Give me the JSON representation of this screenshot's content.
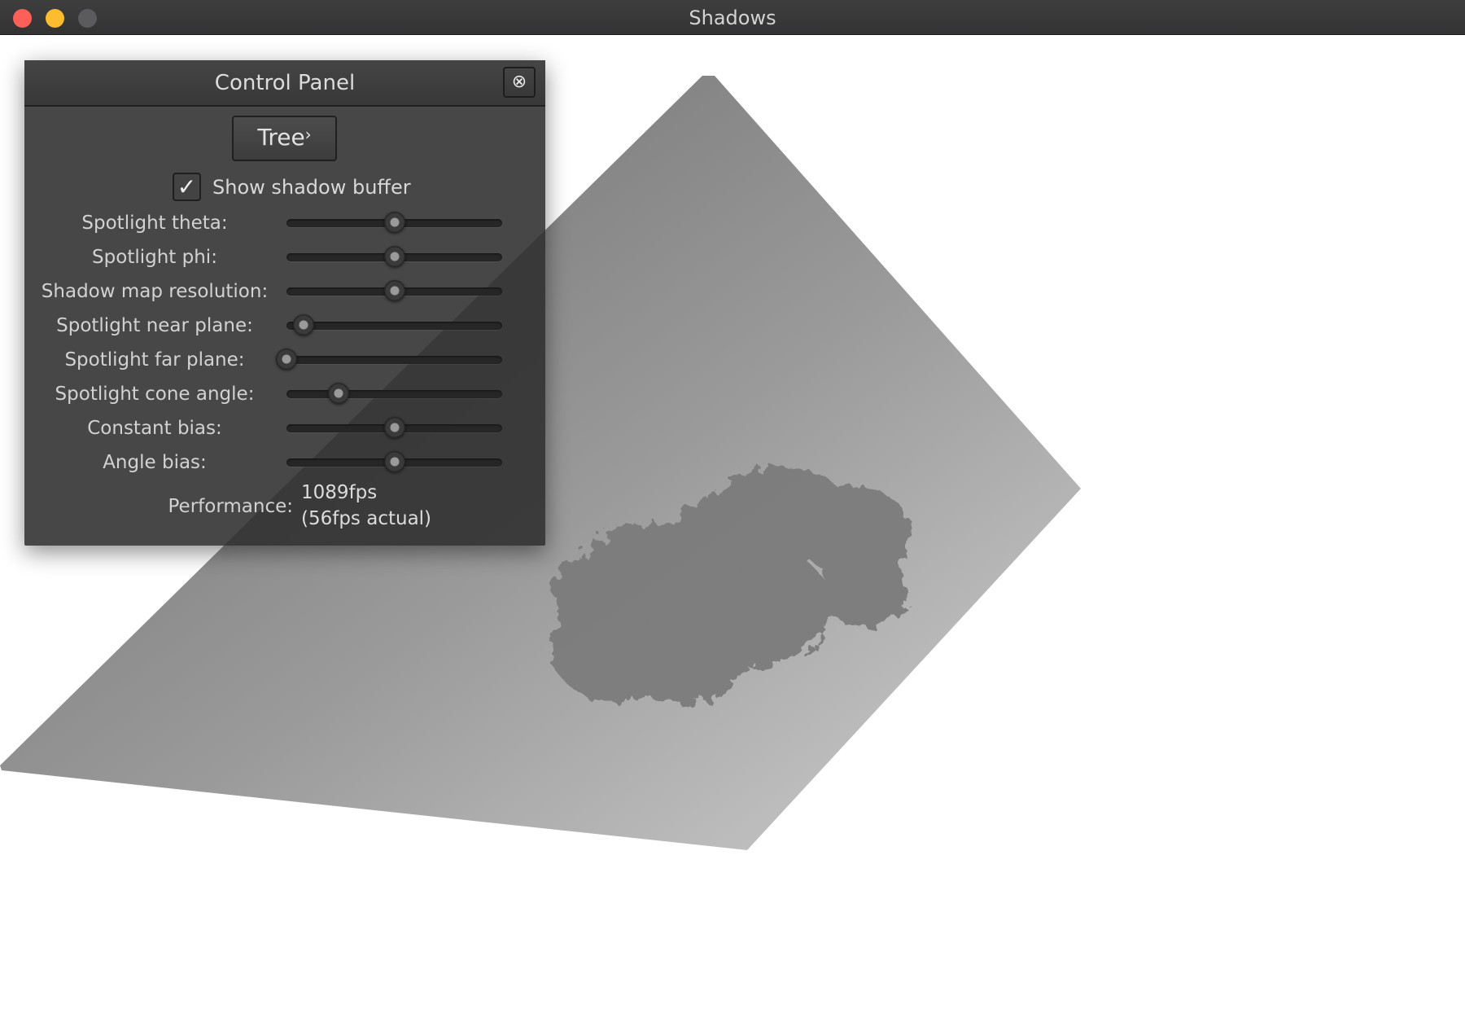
{
  "window": {
    "title": "Shadows"
  },
  "panel": {
    "title": "Control Panel",
    "close_glyph": "⊗",
    "tree_button": {
      "label": "Tree",
      "chevron": "›"
    },
    "show_shadow_buffer": {
      "label": "Show shadow buffer",
      "checked": true,
      "glyph": "✓"
    },
    "sliders": [
      {
        "label": "Spotlight theta:",
        "value": 0.5
      },
      {
        "label": "Spotlight phi:",
        "value": 0.5
      },
      {
        "label": "Shadow map resolution:",
        "value": 0.5
      },
      {
        "label": "Spotlight near plane:",
        "value": 0.08
      },
      {
        "label": "Spotlight far plane:",
        "value": 0.0
      },
      {
        "label": "Spotlight cone angle:",
        "value": 0.24
      },
      {
        "label": "Constant bias:",
        "value": 0.5
      },
      {
        "label": "Angle bias:",
        "value": 0.5
      }
    ],
    "performance": {
      "label": "Performance:",
      "fps": "1089fps",
      "actual": "(56fps actual)"
    }
  },
  "colors": {
    "titlebar": "#373738",
    "close": "#fe5f57",
    "minimize": "#febc2e",
    "maximize": "#5b5b5d",
    "panel_bg": "#2d2d2d",
    "plane_dark": "#707070",
    "plane_light": "#c8c8c8",
    "shadow": "#7a7a7a"
  }
}
